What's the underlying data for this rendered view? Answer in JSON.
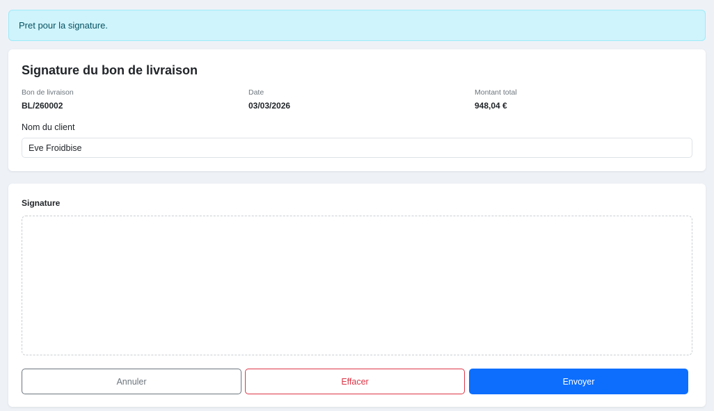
{
  "alert": {
    "message": "Pret pour la signature."
  },
  "info": {
    "title": "Signature du bon de livraison",
    "delivery_note_label": "Bon de livraison",
    "delivery_note_value": "BL/260002",
    "date_label": "Date",
    "date_value": "03/03/2026",
    "total_label": "Montant total",
    "total_value": "948,04 €",
    "client_label": "Nom du client",
    "client_value": "Eve Froidbise"
  },
  "signature": {
    "label": "Signature",
    "buttons": {
      "cancel": "Annuler",
      "clear": "Effacer",
      "send": "Envoyer"
    }
  },
  "colors": {
    "alert_bg": "#cff4fc",
    "alert_text": "#055160",
    "cancel": "#6c757d",
    "clear": "#dc3545",
    "send": "#0d6efd"
  }
}
